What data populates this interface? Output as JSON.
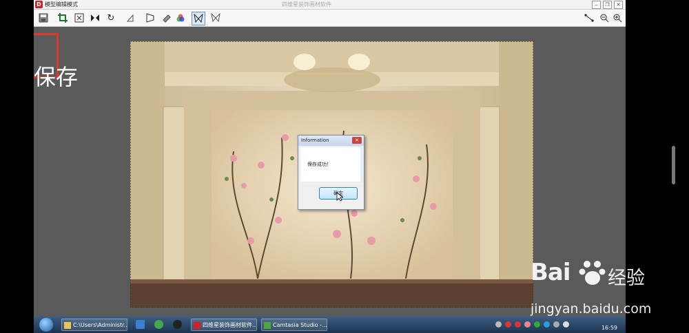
{
  "window": {
    "app_icon": "D",
    "title": "模型编辑模式",
    "center_title": "四维星装饰画材软件",
    "controls": [
      "minimize-icon",
      "restore-icon",
      "close-icon"
    ]
  },
  "toolbar": {
    "tools": [
      "save-icon",
      "crop-icon",
      "fit-icon",
      "flip-icon",
      "rotate-icon",
      "skew-icon",
      "perspective-icon",
      "eraser-icon",
      "color-icon",
      "select-butterfly-icon",
      "butterfly-icon"
    ],
    "right_tools": [
      "measure-icon",
      "zoom-out-icon",
      "zoom-in-icon"
    ],
    "highlight_color": "#d93a2e"
  },
  "annotation": {
    "caption": "保存"
  },
  "dialog": {
    "title": "Information",
    "close_label": "✕",
    "message": "保存成功！",
    "ok_label": "确定"
  },
  "taskbar": {
    "items": [
      {
        "label": "C:\\Users\\Administr...",
        "icon": "folder-icon"
      },
      {
        "label": "四维星装饰画材软件...",
        "icon": "app-icon"
      },
      {
        "label": "Camtasia Studio -...",
        "icon": "camtasia-icon"
      }
    ],
    "clock": "16:59"
  },
  "watermark": {
    "logo_text": "Bai",
    "logo_cn": "经验",
    "url": "jingyan.baidu.com"
  }
}
